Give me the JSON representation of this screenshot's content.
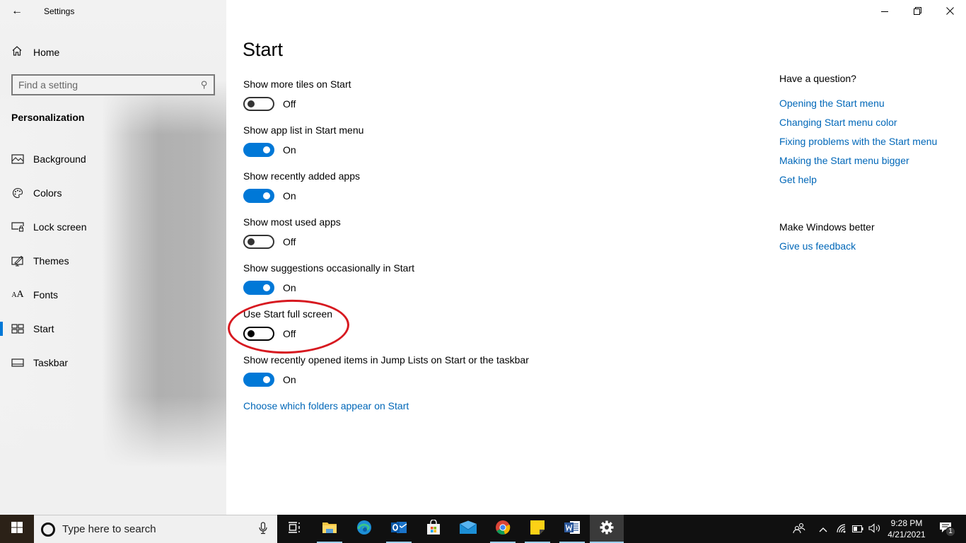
{
  "window": {
    "title": "Settings",
    "controls": {
      "minimize": "—",
      "restore": "❐",
      "close": "✕"
    }
  },
  "sidebar": {
    "back_icon": "arrow-left-icon",
    "home_label": "Home",
    "search_placeholder": "Find a setting",
    "section_title": "Personalization",
    "items": [
      {
        "label": "Background",
        "icon": "picture-icon",
        "active": false
      },
      {
        "label": "Colors",
        "icon": "palette-icon",
        "active": false
      },
      {
        "label": "Lock screen",
        "icon": "lock-screen-icon",
        "active": false
      },
      {
        "label": "Themes",
        "icon": "themes-icon",
        "active": false
      },
      {
        "label": "Fonts",
        "icon": "fonts-icon",
        "active": false
      },
      {
        "label": "Start",
        "icon": "start-tiles-icon",
        "active": true
      },
      {
        "label": "Taskbar",
        "icon": "taskbar-icon",
        "active": false
      }
    ]
  },
  "main": {
    "title": "Start",
    "settings": [
      {
        "label": "Show more tiles on Start",
        "state": "Off",
        "on": false
      },
      {
        "label": "Show app list in Start menu",
        "state": "On",
        "on": true
      },
      {
        "label": "Show recently added apps",
        "state": "On",
        "on": true
      },
      {
        "label": "Show most used apps",
        "state": "Off",
        "on": false
      },
      {
        "label": "Show suggestions occasionally in Start",
        "state": "On",
        "on": true
      },
      {
        "label": "Use Start full screen",
        "state": "Off",
        "on": false,
        "highlighted": true
      },
      {
        "label": "Show recently opened items in Jump Lists on Start or the taskbar",
        "state": "On",
        "on": true
      }
    ],
    "folders_link": "Choose which folders appear on Start"
  },
  "help": {
    "question_heading": "Have a question?",
    "links": [
      "Opening the Start menu",
      "Changing Start menu color",
      "Fixing problems with the Start menu",
      "Making the Start menu bigger",
      "Get help"
    ],
    "feedback_heading": "Make Windows better",
    "feedback_link": "Give us feedback"
  },
  "colors": {
    "accent": "#0078d7",
    "link": "#0067b8",
    "annotation": "#d71920",
    "taskbar": "#101010"
  },
  "taskbar": {
    "search_placeholder": "Type here to search",
    "apps": [
      {
        "name": "task-view",
        "icon": "task-view-icon",
        "running": false
      },
      {
        "name": "file-explorer",
        "icon": "folder-icon",
        "running": true
      },
      {
        "name": "edge",
        "icon": "edge-icon",
        "running": false
      },
      {
        "name": "outlook",
        "icon": "outlook-icon",
        "running": true
      },
      {
        "name": "microsoft-store",
        "icon": "store-icon",
        "running": false
      },
      {
        "name": "mail",
        "icon": "mail-icon",
        "running": false
      },
      {
        "name": "chrome",
        "icon": "chrome-icon",
        "running": true
      },
      {
        "name": "sticky-notes",
        "icon": "sticky-notes-icon",
        "running": true
      },
      {
        "name": "word",
        "icon": "word-icon",
        "running": true
      },
      {
        "name": "settings",
        "icon": "gear-icon",
        "running": true,
        "active": true
      }
    ],
    "tray": {
      "time": "9:28 PM",
      "date": "4/21/2021",
      "notification_count": "1"
    }
  }
}
